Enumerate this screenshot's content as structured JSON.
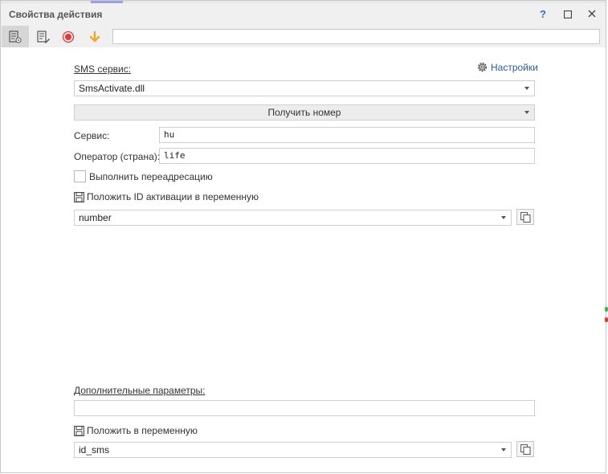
{
  "window": {
    "title": "Свойства действия",
    "help_label": "?",
    "maximize_label": "☐",
    "close_label": "✕"
  },
  "toolbar": {
    "search_value": "",
    "icons": [
      "action-properties-icon",
      "edit-notes-icon",
      "record-icon",
      "arrow-down-icon"
    ]
  },
  "sms": {
    "label": "SMS сервис:",
    "settings_label": "Настройки",
    "provider_value": "SmsActivate.dll",
    "action_value": "Получить номер"
  },
  "fields": {
    "service_label": "Сервис:",
    "service_value": "hu",
    "operator_label": "Оператор (страна):",
    "operator_value": "life"
  },
  "redirect": {
    "label": "Выполнить переадресацию",
    "checked": false
  },
  "activation": {
    "label": "Положить ID активации в переменную",
    "variable_value": "number"
  },
  "extra": {
    "label": "Дополнительные параметры:",
    "value": ""
  },
  "result": {
    "label": "Положить в переменную",
    "variable_value": "id_sms"
  },
  "colors": {
    "accent": "#2b5aa8",
    "record": "#e53935",
    "arrow": "#f5a623"
  }
}
